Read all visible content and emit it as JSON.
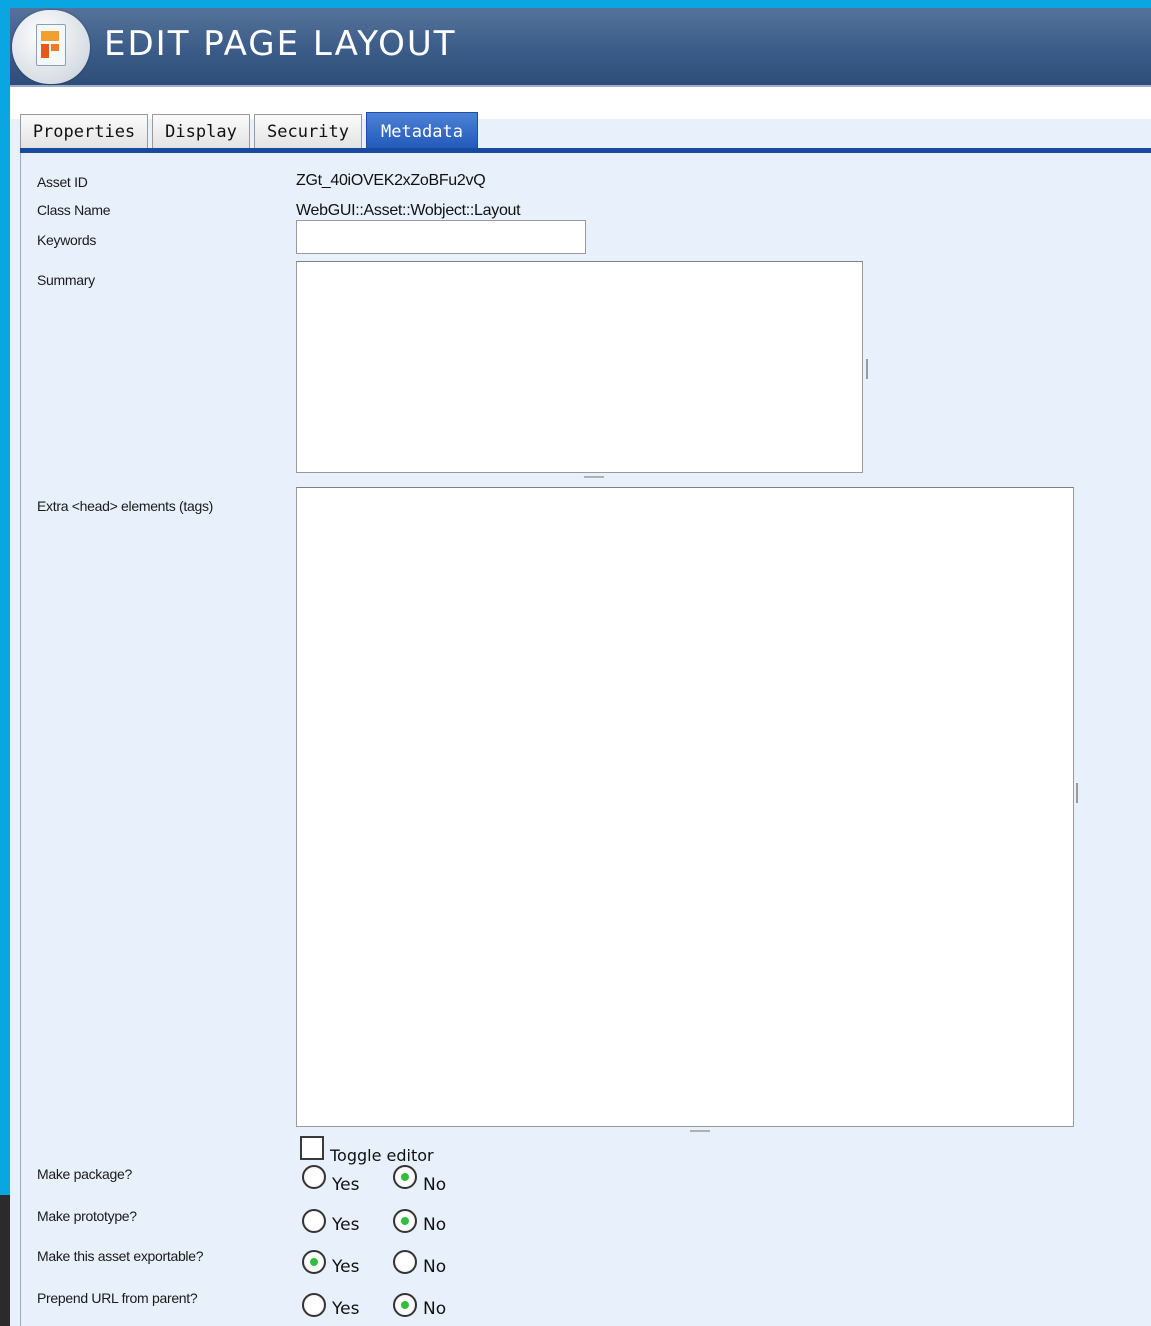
{
  "window": {
    "title": "EDIT PAGE LAYOUT",
    "icon": "page-layout-icon"
  },
  "tabs": [
    {
      "label": "Properties",
      "active": false
    },
    {
      "label": "Display",
      "active": false
    },
    {
      "label": "Security",
      "active": false
    },
    {
      "label": "Metadata",
      "active": true
    }
  ],
  "fields": {
    "asset_id": {
      "label": "Asset ID",
      "value": "ZGt_40iOVEK2xZoBFu2vQ"
    },
    "class_name": {
      "label": "Class Name",
      "value": "WebGUI::Asset::Wobject::Layout"
    },
    "keywords": {
      "label": "Keywords",
      "value": ""
    },
    "summary": {
      "label": "Summary",
      "value": ""
    },
    "extra_head": {
      "label": "Extra <head> elements (tags)",
      "value": ""
    },
    "toggle_editor": {
      "label": "Toggle editor",
      "checked": false
    },
    "make_package": {
      "label": "Make package?",
      "yes": "Yes",
      "no": "No",
      "selected": "No"
    },
    "make_prototype": {
      "label": "Make prototype?",
      "yes": "Yes",
      "no": "No",
      "selected": "No"
    },
    "exportable": {
      "label": "Make this asset exportable?",
      "yes": "Yes",
      "no": "No",
      "selected": "Yes"
    },
    "prepend_url": {
      "label": "Prepend URL from parent?",
      "yes": "Yes",
      "no": "No",
      "selected": "No"
    }
  },
  "colors": {
    "accent": "#1a4aa0",
    "titlebar": "#3b5c88",
    "background": "#0aa6e2",
    "radio_fill": "#2fbf3c"
  }
}
